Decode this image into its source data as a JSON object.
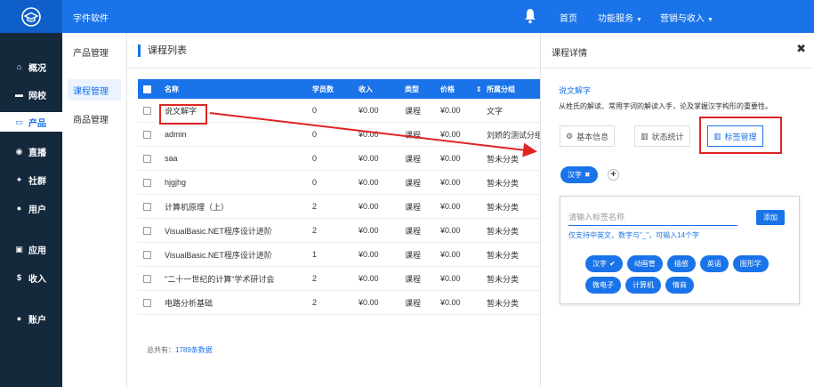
{
  "app": {
    "brand": "字件软件"
  },
  "topnav": [
    {
      "label": "首页",
      "caret": ""
    },
    {
      "label": "功能服务",
      "caret": "▼"
    },
    {
      "label": "营销与收入",
      "caret": "▼"
    }
  ],
  "sidebar": [
    {
      "label": "概况",
      "icon": "home-icon",
      "glyph": "⌂"
    },
    {
      "label": "网校",
      "icon": "school-icon",
      "glyph": "▬"
    },
    {
      "label": "产品",
      "icon": "product-icon",
      "glyph": "▭"
    },
    {
      "label": "直播",
      "icon": "live-icon",
      "glyph": "◉"
    },
    {
      "label": "社群",
      "icon": "community-icon",
      "glyph": "✦"
    },
    {
      "label": "用户",
      "icon": "user-icon",
      "glyph": "●"
    },
    {
      "label": "应用",
      "icon": "app-icon",
      "glyph": "▣"
    },
    {
      "label": "收入",
      "icon": "income-icon",
      "glyph": "$"
    },
    {
      "label": "账户",
      "icon": "account-icon",
      "glyph": "●"
    }
  ],
  "subnav": {
    "title": "产品管理",
    "items": [
      "课程管理",
      "商品管理"
    ]
  },
  "main": {
    "title": "课程列表",
    "total_label": "总共有：",
    "total_value": "1789条数据"
  },
  "table": {
    "headers": [
      "名称",
      "学员数",
      "收入",
      "类型",
      "价格",
      "所属分组"
    ],
    "sort_glyph": "⇕",
    "rows": [
      {
        "name": "说文解字",
        "students": "0",
        "income": "¥0.00",
        "type": "课程",
        "price": "¥0.00",
        "group": "文字"
      },
      {
        "name": "admin",
        "students": "0",
        "income": "¥0.00",
        "type": "课程",
        "price": "¥0.00",
        "group": "刘娇的测试分组"
      },
      {
        "name": "saa",
        "students": "0",
        "income": "¥0.00",
        "type": "课程",
        "price": "¥0.00",
        "group": "暂未分类"
      },
      {
        "name": "hjgjhg",
        "students": "0",
        "income": "¥0.00",
        "type": "课程",
        "price": "¥0.00",
        "group": "暂未分类"
      },
      {
        "name": "计算机原理（上）",
        "students": "2",
        "income": "¥0.00",
        "type": "课程",
        "price": "¥0.00",
        "group": "暂未分类"
      },
      {
        "name": "VisualBasic.NET程序设计进阶",
        "students": "2",
        "income": "¥0.00",
        "type": "课程",
        "price": "¥0.00",
        "group": "暂未分类"
      },
      {
        "name": "VisualBasic.NET程序设计进阶",
        "students": "1",
        "income": "¥0.00",
        "type": "课程",
        "price": "¥0.00",
        "group": "暂未分类"
      },
      {
        "name": "\"二十一世纪的计算\"学术研讨会",
        "students": "2",
        "income": "¥0.00",
        "type": "课程",
        "price": "¥0.00",
        "group": "暂未分类"
      },
      {
        "name": "电路分析基础",
        "students": "2",
        "income": "¥0.00",
        "type": "课程",
        "price": "¥0.00",
        "group": "暂未分类"
      }
    ]
  },
  "panel": {
    "title": "课程详情",
    "close": "✖",
    "course_name": "说文解字",
    "course_desc": "从姓氏的解读、常用字词的解读入手，论及掌握汉字构形的重要性。",
    "tabs": [
      {
        "label": "基本信息",
        "icon": "gear-icon",
        "glyph": "⚙"
      },
      {
        "label": "状态统计",
        "icon": "chart-icon",
        "glyph": "▥"
      },
      {
        "label": "标签管理",
        "icon": "bar-chart-icon",
        "glyph": "▥"
      }
    ],
    "current_tags": [
      {
        "label": "汉字",
        "remove": "✖"
      }
    ],
    "add_glyph": "+",
    "tag_input": {
      "placeholder": "请输入标签名称",
      "value": ""
    },
    "add_button": "添加",
    "hint": "仅支持中英文，数字与\"_\"，可输入14个字",
    "options": [
      {
        "label": "汉字",
        "mark": "✔"
      },
      {
        "label": "动画管",
        "mark": ""
      },
      {
        "label": "插感",
        "mark": ""
      },
      {
        "label": "英语",
        "mark": ""
      },
      {
        "label": "图形学",
        "mark": ""
      },
      {
        "label": "微电子",
        "mark": ""
      },
      {
        "label": "计算机",
        "mark": ""
      },
      {
        "label": "情商",
        "mark": ""
      }
    ]
  },
  "colors": {
    "primary": "#1a73e8",
    "sidebar": "#15293d",
    "highlight": "#e02424"
  }
}
